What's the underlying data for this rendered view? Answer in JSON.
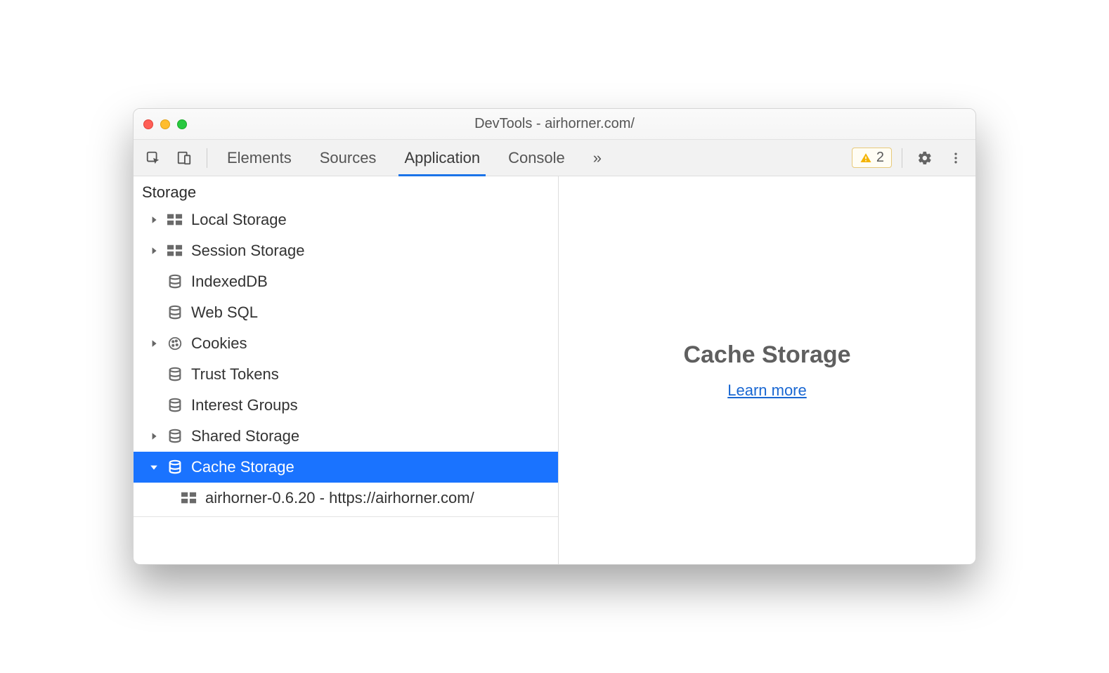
{
  "window": {
    "title": "DevTools - airhorner.com/"
  },
  "tabs": {
    "items": [
      "Elements",
      "Sources",
      "Application",
      "Console"
    ],
    "active": "Application",
    "overflow": "»"
  },
  "toolbar": {
    "warning_count": "2"
  },
  "sidebar": {
    "section": "Storage",
    "items": [
      {
        "label": "Local Storage",
        "icon": "grid",
        "expandable": true,
        "expanded": false
      },
      {
        "label": "Session Storage",
        "icon": "grid",
        "expandable": true,
        "expanded": false
      },
      {
        "label": "IndexedDB",
        "icon": "db",
        "expandable": false
      },
      {
        "label": "Web SQL",
        "icon": "db",
        "expandable": false
      },
      {
        "label": "Cookies",
        "icon": "cookie",
        "expandable": true,
        "expanded": false
      },
      {
        "label": "Trust Tokens",
        "icon": "db",
        "expandable": false
      },
      {
        "label": "Interest Groups",
        "icon": "db",
        "expandable": false
      },
      {
        "label": "Shared Storage",
        "icon": "db",
        "expandable": true,
        "expanded": false
      },
      {
        "label": "Cache Storage",
        "icon": "db",
        "expandable": true,
        "expanded": true,
        "selected": true,
        "children": [
          {
            "label": "airhorner-0.6.20 - https://airhorner.com/",
            "icon": "grid"
          }
        ]
      }
    ]
  },
  "main": {
    "heading": "Cache Storage",
    "link": "Learn more"
  }
}
